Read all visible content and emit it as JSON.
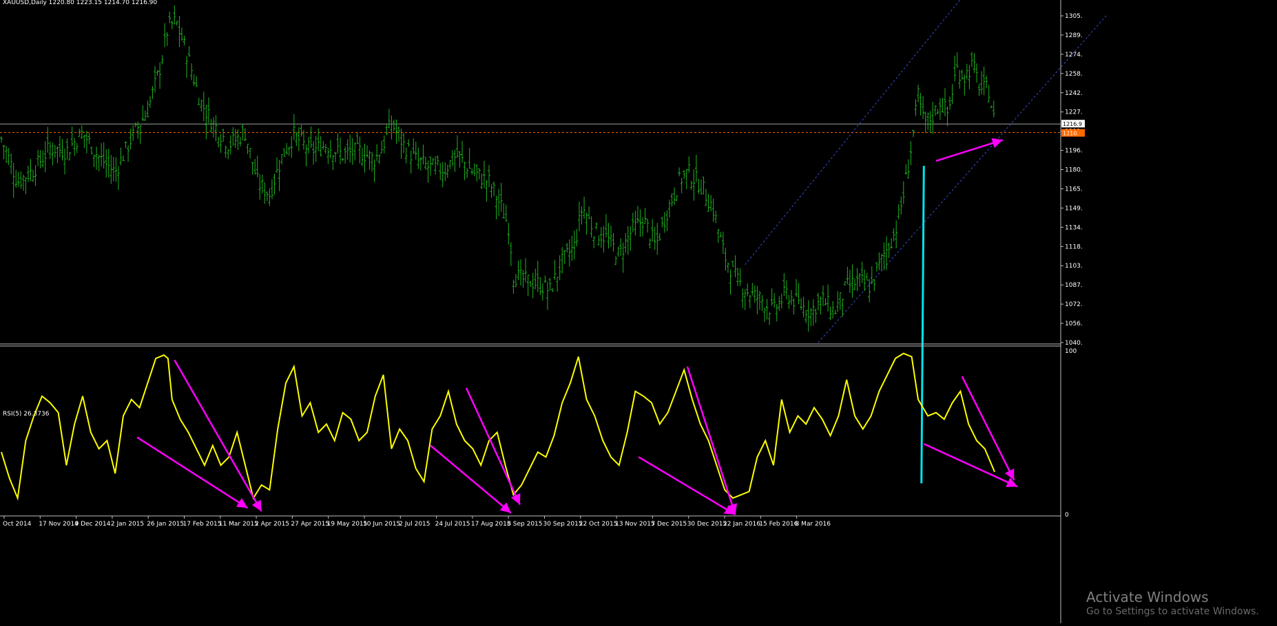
{
  "window": {
    "symbol_title": "XAUUSD,Daily",
    "ohlc_text": "1220.80 1223.15 1214.70 1216.90",
    "indicator_title": "RSI(5) 26.3736"
  },
  "price_axis": {
    "ticks": [
      "1305.",
      "1289.",
      "1274.",
      "1258.",
      "1242.",
      "1227.",
      "1211.",
      "1196.",
      "1180.",
      "1165.",
      "1149.",
      "1134.",
      "1118.",
      "1103.",
      "1087.",
      "1072.",
      "1056.",
      "1040."
    ],
    "current_price_label": "1216.9",
    "line_price_label": "1210."
  },
  "rsi_axis": {
    "top": "100",
    "bottom": "0"
  },
  "time_axis": {
    "labels": [
      "Oct 2014",
      "17 Nov 2014",
      "9 Dec 2014",
      "2 Jan 2015",
      "26 Jan 2015",
      "17 Feb 2015",
      "11 Mar 2015",
      "2 Apr 2015",
      "27 Apr 2015",
      "19 May 2015",
      "10 Jun 2015",
      "2 Jul 2015",
      "24 Jul 2015",
      "17 Aug 2015",
      "8 Sep 2015",
      "30 Sep 2015",
      "22 Oct 2015",
      "13 Nov 2015",
      "7 Dec 2015",
      "30 Dec 2015",
      "22 Jan 2016",
      "15 Feb 2016",
      "8 Mar 2016"
    ]
  },
  "colors": {
    "background": "#000000",
    "price_bars": "#1fb51f",
    "rsi_line": "#ffff00",
    "annotation_arrows": "#ff00ff",
    "vertical_marker": "#00e5ee",
    "channel_lines": "#3a4ccf",
    "horizontal_level": "#a0a0a0",
    "dashed_level": "#ff6a00",
    "separator": "#c0c0c0"
  },
  "chart_data": [
    {
      "type": "ohlc",
      "x_range": [
        "Oct 2014",
        "Mar 2016"
      ],
      "ylim": [
        1040,
        1305
      ],
      "close_points": [
        [
          0,
          1205
        ],
        [
          20,
          1170
        ],
        [
          40,
          1180
        ],
        [
          60,
          1198
        ],
        [
          80,
          1195
        ],
        [
          100,
          1210
        ],
        [
          120,
          1190
        ],
        [
          140,
          1178
        ],
        [
          160,
          1205
        ],
        [
          180,
          1228
        ],
        [
          195,
          1262
        ],
        [
          205,
          1295
        ],
        [
          215,
          1300
        ],
        [
          230,
          1270
        ],
        [
          245,
          1235
        ],
        [
          260,
          1218
        ],
        [
          280,
          1200
        ],
        [
          300,
          1210
        ],
        [
          315,
          1170
        ],
        [
          330,
          1160
        ],
        [
          345,
          1190
        ],
        [
          360,
          1208
        ],
        [
          380,
          1195
        ],
        [
          400,
          1200
        ],
        [
          420,
          1192
        ],
        [
          440,
          1195
        ],
        [
          460,
          1188
        ],
        [
          470,
          1200
        ],
        [
          480,
          1218
        ],
        [
          495,
          1200
        ],
        [
          510,
          1188
        ],
        [
          525,
          1182
        ],
        [
          545,
          1180
        ],
        [
          560,
          1192
        ],
        [
          580,
          1178
        ],
        [
          600,
          1170
        ],
        [
          615,
          1150
        ],
        [
          625,
          1132
        ],
        [
          630,
          1095
        ],
        [
          645,
          1090
        ],
        [
          660,
          1088
        ],
        [
          675,
          1082
        ],
        [
          690,
          1105
        ],
        [
          705,
          1118
        ],
        [
          715,
          1150
        ],
        [
          730,
          1130
        ],
        [
          745,
          1125
        ],
        [
          760,
          1110
        ],
        [
          775,
          1130
        ],
        [
          790,
          1140
        ],
        [
          805,
          1118
        ],
        [
          820,
          1148
        ],
        [
          835,
          1172
        ],
        [
          845,
          1178
        ],
        [
          860,
          1168
        ],
        [
          875,
          1150
        ],
        [
          890,
          1110
        ],
        [
          905,
          1090
        ],
        [
          920,
          1080
        ],
        [
          935,
          1075
        ],
        [
          950,
          1065
        ],
        [
          965,
          1080
        ],
        [
          980,
          1072
        ],
        [
          995,
          1065
        ],
        [
          1010,
          1075
        ],
        [
          1025,
          1065
        ],
        [
          1040,
          1085
        ],
        [
          1055,
          1090
        ],
        [
          1070,
          1085
        ],
        [
          1085,
          1110
        ],
        [
          1100,
          1130
        ],
        [
          1110,
          1160
        ],
        [
          1120,
          1200
        ],
        [
          1128,
          1240
        ],
        [
          1135,
          1218
        ],
        [
          1145,
          1222
        ],
        [
          1155,
          1235
        ],
        [
          1165,
          1225
        ],
        [
          1175,
          1262
        ],
        [
          1185,
          1255
        ],
        [
          1195,
          1265
        ],
        [
          1205,
          1245
        ],
        [
          1215,
          1245
        ],
        [
          1222,
          1217
        ]
      ],
      "channel_line_1": [
        [
          915,
          1103
        ],
        [
          1195,
          1330
        ]
      ],
      "channel_line_2": [
        [
          1005,
          1040
        ],
        [
          1360,
          1305
        ]
      ],
      "horizontal_level": 1216.9,
      "dashed_level": 1210,
      "arrow_up": [
        [
          1150,
          1187
        ],
        [
          1232,
          1204
        ]
      ],
      "vertical_marker": [
        [
          1135,
          1183
        ],
        [
          1132,
          19
        ]
      ]
    },
    {
      "type": "line",
      "series": [
        {
          "name": "RSI(5)",
          "points": [
            [
              0,
              38
            ],
            [
              10,
              22
            ],
            [
              20,
              10
            ],
            [
              30,
              45
            ],
            [
              40,
              60
            ],
            [
              50,
              72
            ],
            [
              60,
              68
            ],
            [
              70,
              62
            ],
            [
              80,
              30
            ],
            [
              90,
              55
            ],
            [
              100,
              72
            ],
            [
              110,
              50
            ],
            [
              120,
              40
            ],
            [
              130,
              45
            ],
            [
              140,
              25
            ],
            [
              150,
              60
            ],
            [
              160,
              70
            ],
            [
              170,
              65
            ],
            [
              180,
              80
            ],
            [
              190,
              95
            ],
            [
              200,
              97
            ],
            [
              205,
              95
            ],
            [
              210,
              70
            ],
            [
              220,
              58
            ],
            [
              230,
              50
            ],
            [
              240,
              40
            ],
            [
              250,
              30
            ],
            [
              260,
              42
            ],
            [
              270,
              30
            ],
            [
              280,
              35
            ],
            [
              290,
              50
            ],
            [
              300,
              30
            ],
            [
              310,
              10
            ],
            [
              320,
              18
            ],
            [
              330,
              15
            ],
            [
              340,
              52
            ],
            [
              350,
              80
            ],
            [
              360,
              90
            ],
            [
              370,
              60
            ],
            [
              380,
              68
            ],
            [
              390,
              50
            ],
            [
              400,
              55
            ],
            [
              410,
              45
            ],
            [
              420,
              62
            ],
            [
              430,
              58
            ],
            [
              440,
              45
            ],
            [
              450,
              50
            ],
            [
              460,
              72
            ],
            [
              470,
              85
            ],
            [
              480,
              40
            ],
            [
              490,
              52
            ],
            [
              500,
              45
            ],
            [
              510,
              28
            ],
            [
              520,
              20
            ],
            [
              530,
              52
            ],
            [
              540,
              60
            ],
            [
              550,
              75
            ],
            [
              560,
              55
            ],
            [
              570,
              45
            ],
            [
              580,
              40
            ],
            [
              590,
              30
            ],
            [
              600,
              45
            ],
            [
              610,
              50
            ],
            [
              620,
              30
            ],
            [
              630,
              12
            ],
            [
              640,
              18
            ],
            [
              650,
              28
            ],
            [
              660,
              38
            ],
            [
              670,
              35
            ],
            [
              680,
              48
            ],
            [
              690,
              68
            ],
            [
              700,
              80
            ],
            [
              710,
              96
            ],
            [
              720,
              70
            ],
            [
              730,
              60
            ],
            [
              740,
              45
            ],
            [
              750,
              35
            ],
            [
              760,
              30
            ],
            [
              770,
              50
            ],
            [
              780,
              75
            ],
            [
              790,
              72
            ],
            [
              800,
              68
            ],
            [
              810,
              55
            ],
            [
              820,
              62
            ],
            [
              830,
              75
            ],
            [
              840,
              88
            ],
            [
              850,
              70
            ],
            [
              860,
              55
            ],
            [
              870,
              45
            ],
            [
              880,
              30
            ],
            [
              890,
              15
            ],
            [
              900,
              10
            ],
            [
              910,
              12
            ],
            [
              920,
              14
            ],
            [
              930,
              35
            ],
            [
              940,
              45
            ],
            [
              950,
              30
            ],
            [
              960,
              70
            ],
            [
              970,
              50
            ],
            [
              980,
              60
            ],
            [
              990,
              55
            ],
            [
              1000,
              65
            ],
            [
              1010,
              58
            ],
            [
              1020,
              48
            ],
            [
              1030,
              60
            ],
            [
              1040,
              82
            ],
            [
              1050,
              60
            ],
            [
              1060,
              52
            ],
            [
              1070,
              60
            ],
            [
              1080,
              75
            ],
            [
              1090,
              85
            ],
            [
              1100,
              95
            ],
            [
              1110,
              98
            ],
            [
              1120,
              96
            ],
            [
              1128,
              70
            ],
            [
              1140,
              60
            ],
            [
              1150,
              62
            ],
            [
              1160,
              58
            ],
            [
              1170,
              68
            ],
            [
              1180,
              75
            ],
            [
              1190,
              55
            ],
            [
              1200,
              45
            ],
            [
              1210,
              40
            ],
            [
              1222,
              26
            ]
          ]
        }
      ],
      "ylim": [
        0,
        100
      ],
      "divergence_arrows": [
        [
          [
            167,
            47
          ],
          [
            303,
            4
          ]
        ],
        [
          [
            213,
            94
          ],
          [
            320,
            2
          ]
        ],
        [
          [
            528,
            42
          ],
          [
            627,
            1
          ]
        ],
        [
          [
            572,
            77
          ],
          [
            638,
            6
          ]
        ],
        [
          [
            784,
            35
          ],
          [
            903,
            0
          ]
        ],
        [
          [
            844,
            90
          ],
          [
            903,
            0
          ]
        ],
        [
          [
            1135,
            43
          ],
          [
            1250,
            17
          ]
        ],
        [
          [
            1182,
            84
          ],
          [
            1246,
            21
          ]
        ]
      ]
    }
  ],
  "watermark": {
    "title": "Activate Windows",
    "subtitle": "Go to Settings to activate Windows."
  }
}
